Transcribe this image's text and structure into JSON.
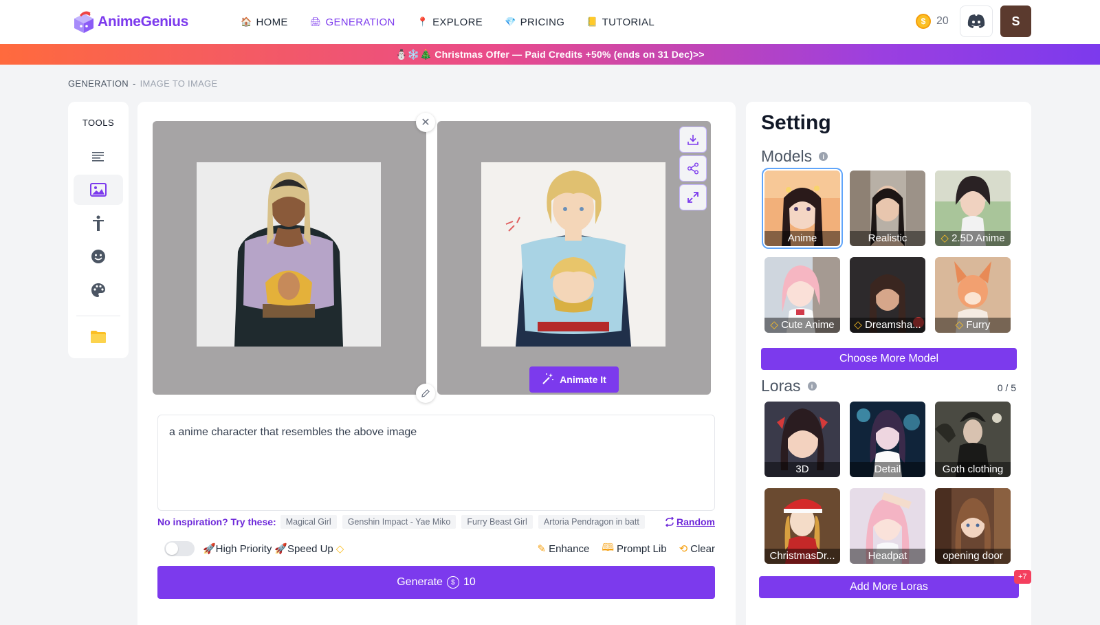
{
  "app": {
    "name": "AnimeGenius"
  },
  "nav": [
    {
      "label": "HOME",
      "icon": "house-icon",
      "active": false
    },
    {
      "label": "GENERATION",
      "icon": "printer-icon",
      "active": true
    },
    {
      "label": "EXPLORE",
      "icon": "pin-icon",
      "active": false
    },
    {
      "label": "PRICING",
      "icon": "diamond-icon",
      "active": false
    },
    {
      "label": "TUTORIAL",
      "icon": "book-icon",
      "active": false
    }
  ],
  "header": {
    "credits": "20",
    "avatar_letter": "S",
    "coin_symbol": "$"
  },
  "banner": {
    "text": "⛄❄️🎄 Christmas Offer — Paid Credits +50% (ends on 31 Dec)>>"
  },
  "breadcrumb": {
    "parent": "GENERATION",
    "separator": "-",
    "current": "IMAGE TO IMAGE"
  },
  "tools": {
    "title": "TOOLS"
  },
  "editor": {
    "animate_label": "Animate It",
    "prompt_value": "a anime character that resembles the above image",
    "inspire_label": "No inspiration? Try these:",
    "suggestions": [
      "Magical Girl",
      "Genshin Impact - Yae Miko",
      "Furry Beast Girl",
      "Artoria Pendragon in batt"
    ],
    "random_label": "Random",
    "high_priority_label": "🚀High Priority",
    "speed_up_label": "🚀Speed Up",
    "enhance_label": "Enhance",
    "prompt_lib_label": "Prompt Lib",
    "clear_label": "Clear",
    "generate_label": "Generate",
    "generate_cost": "10"
  },
  "settings": {
    "title": "Setting",
    "models_title": "Models",
    "models": [
      {
        "label": "Anime",
        "premium": false,
        "selected": true
      },
      {
        "label": "Realistic",
        "premium": false,
        "selected": false
      },
      {
        "label": "2.5D Anime",
        "premium": true,
        "selected": false
      },
      {
        "label": "Cute Anime",
        "premium": true,
        "selected": false
      },
      {
        "label": "Dreamsha...",
        "premium": true,
        "selected": false
      },
      {
        "label": "Furry",
        "premium": true,
        "selected": false
      }
    ],
    "choose_more_label": "Choose More Model",
    "loras_title": "Loras",
    "loras_count": "0 / 5",
    "loras": [
      {
        "label": "3D"
      },
      {
        "label": "Detail"
      },
      {
        "label": "Goth clothing"
      },
      {
        "label": "ChristmasDr..."
      },
      {
        "label": "Headpat"
      },
      {
        "label": "opening door"
      }
    ],
    "add_loras_label": "Add More Loras",
    "more_badge": "+7"
  },
  "colors": {
    "accent": "#7c3aed",
    "banner_start": "#ff6a3d",
    "banner_end": "#7c3aed"
  }
}
